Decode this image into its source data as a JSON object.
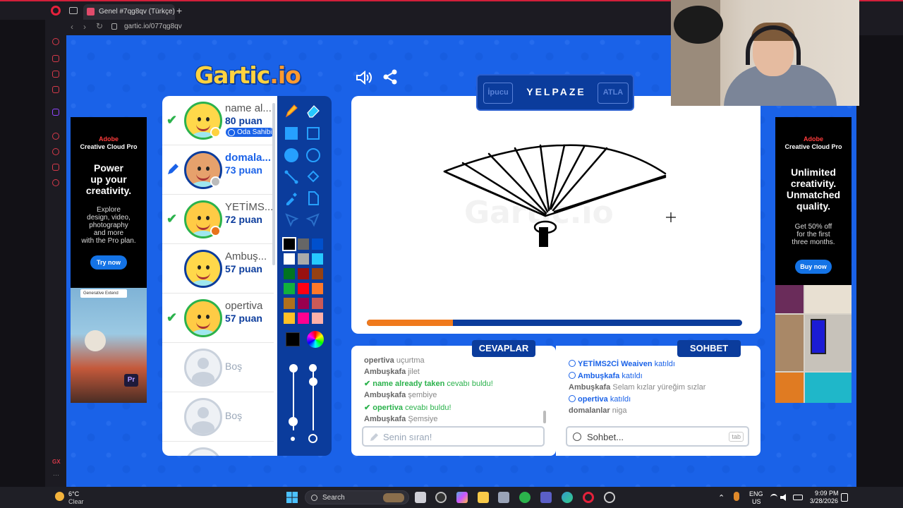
{
  "browser": {
    "tab_title": "Genel #7qg8qv (Türkçe) -",
    "url": "gartic.io/077qg8qv"
  },
  "game": {
    "logo_main": "Gartic",
    "logo_io": ".io",
    "players": [
      {
        "name": "name al...",
        "score": "80 puan",
        "badge": "Oda Sahibi",
        "status": "guessed"
      },
      {
        "name": "domala...",
        "score": "73 puan",
        "status": "drawing"
      },
      {
        "name": "YETİMS...",
        "score": "72 puan",
        "status": "guessed"
      },
      {
        "name": "Ambuş...",
        "score": "57 puan",
        "status": "none"
      },
      {
        "name": "opertiva",
        "score": "57 puan",
        "status": "guessed"
      },
      {
        "empty": "Boş"
      },
      {
        "empty": "Boş"
      }
    ],
    "word_bar": {
      "hint_label": "İpucu",
      "word": "YELPAZE",
      "skip_label": "ATLA"
    },
    "progress_fraction": 0.23,
    "palette": [
      "#000000",
      "#666666",
      "#0050cd",
      "#ffffff",
      "#aaaaaa",
      "#26c9ff",
      "#017420",
      "#991111",
      "#964112",
      "#11b03c",
      "#ff0013",
      "#ff7829",
      "#b0701c",
      "#99004e",
      "#cb5a57",
      "#ffc126",
      "#ff008f",
      "#feafa8"
    ],
    "answers_title": "CEVAPLAR",
    "chat_title": "SOHBET",
    "answers": [
      {
        "user": "opertiva",
        "text": "uçurtma",
        "type": "plain"
      },
      {
        "user": "Ambuşkafa",
        "text": "jilet",
        "type": "plain"
      },
      {
        "user": "name already taken",
        "text": "cevabı buldu!",
        "type": "found"
      },
      {
        "user": "Ambuşkafa",
        "text": "şembiye",
        "type": "plain"
      },
      {
        "user": "opertiva",
        "text": "cevabı buldu!",
        "type": "found"
      },
      {
        "user": "Ambuşkafa",
        "text": "Şemsiye",
        "type": "plain"
      }
    ],
    "chat": [
      {
        "user": "YETİMS2Cİ Weaiven",
        "text": "katıldı",
        "type": "info"
      },
      {
        "user": "Ambuşkafa",
        "text": "katıldı",
        "type": "info"
      },
      {
        "user": "Ambuşkafa",
        "text": "Selam kızlar yüreğim sızlar",
        "type": "plain"
      },
      {
        "user": "opertiva",
        "text": "katıldı",
        "type": "info"
      },
      {
        "user": "domalanlar",
        "text": "niga",
        "type": "plain"
      }
    ],
    "answer_placeholder": "Senin sıran!",
    "chat_placeholder": "Sohbet...",
    "chat_key_hint": "tab"
  },
  "ads": {
    "left": {
      "brand_top": "Adobe",
      "brand": "Creative Cloud Pro",
      "headline": [
        "Power",
        "up your",
        "creativity."
      ],
      "sub": [
        "Explore",
        "design, video,",
        "photography",
        "and more",
        "with the Pro plan."
      ],
      "cta": "Try now",
      "chip": "Generative Extend",
      "pr": "Pr"
    },
    "right": {
      "brand_top": "Adobe",
      "brand": "Creative Cloud Pro",
      "headline": [
        "Unlimited",
        "creativity.",
        "Unmatched",
        "quality."
      ],
      "sub": [
        "Get 50% off",
        "for the first",
        "three months."
      ],
      "cta": "Buy now"
    }
  },
  "taskbar": {
    "weather_temp": "6°C",
    "weather_desc": "Clear",
    "search": "Search",
    "lang": "ENG",
    "region": "US",
    "time": "9:09 PM",
    "date": "3/28/2026",
    "sidebar_gx": "GX"
  },
  "colors": {
    "page_bg": "#1a62e8",
    "navy": "#0b3c9c",
    "accent_orange": "#f07a1c",
    "found_green": "#2bb24c"
  }
}
